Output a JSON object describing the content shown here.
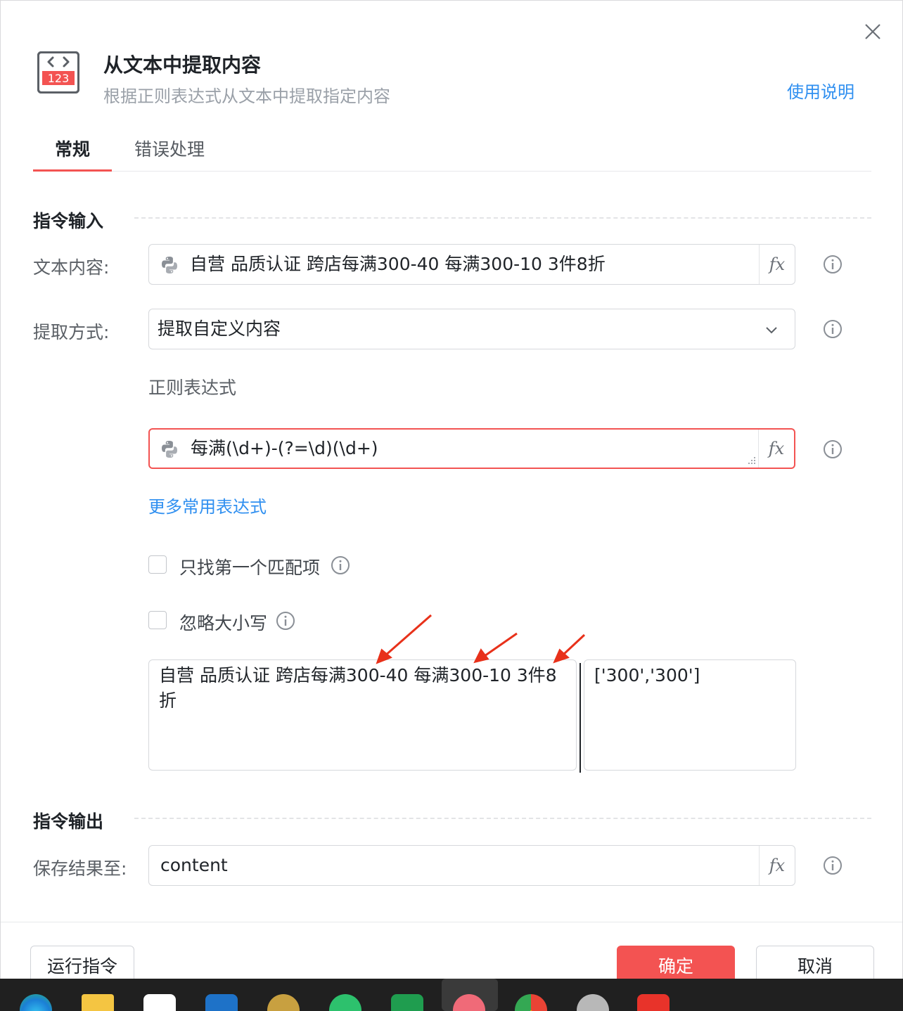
{
  "dialog": {
    "title": "从文本中提取内容",
    "subtitle": "根据正则表达式从文本中提取指定内容",
    "help_link": "使用说明",
    "app_icon_text": "123",
    "close_icon": "close-icon"
  },
  "tabs": [
    {
      "label": "常规",
      "active": true
    },
    {
      "label": "错误处理",
      "active": false
    }
  ],
  "input_section": {
    "heading": "指令输入",
    "text_content": {
      "label": "文本内容:",
      "value": "自营 品质认证 跨店每满300-40 每满300-10 3件8折",
      "fx": "fx"
    },
    "extract_mode": {
      "label": "提取方式:",
      "selected": "提取自定义内容"
    },
    "regex": {
      "label": "正则表达式",
      "value": "每满(\\d+)-(?=\\d)(\\d+)",
      "fx": "fx"
    },
    "more_link": "更多常用表达式",
    "first_match_only": {
      "label": "只找第一个匹配项",
      "checked": false
    },
    "ignore_case": {
      "label": "忽略大小写",
      "checked": false
    },
    "test_input": "自营 品质认证 跨店每满300-40 每满300-10 3件8折",
    "test_output": "['300','300']"
  },
  "output_section": {
    "heading": "指令输出",
    "save_to": {
      "label": "保存结果至:",
      "value": "content",
      "fx": "fx"
    }
  },
  "footer": {
    "run_button": "运行指令",
    "ok_button": "确定",
    "cancel_button": "取消"
  },
  "colors": {
    "accent_red": "#f35352",
    "link_blue": "#2f8ff0",
    "annotation_arrow": "#e8311a"
  },
  "taskbar_icons": [
    "edge-icon",
    "file-explorer-icon",
    "store-icon",
    "mail-icon",
    "app-icon",
    "wechat-icon",
    "app-icon",
    "yingdao-icon",
    "chrome-icon",
    "app-icon",
    "wps-icon"
  ]
}
